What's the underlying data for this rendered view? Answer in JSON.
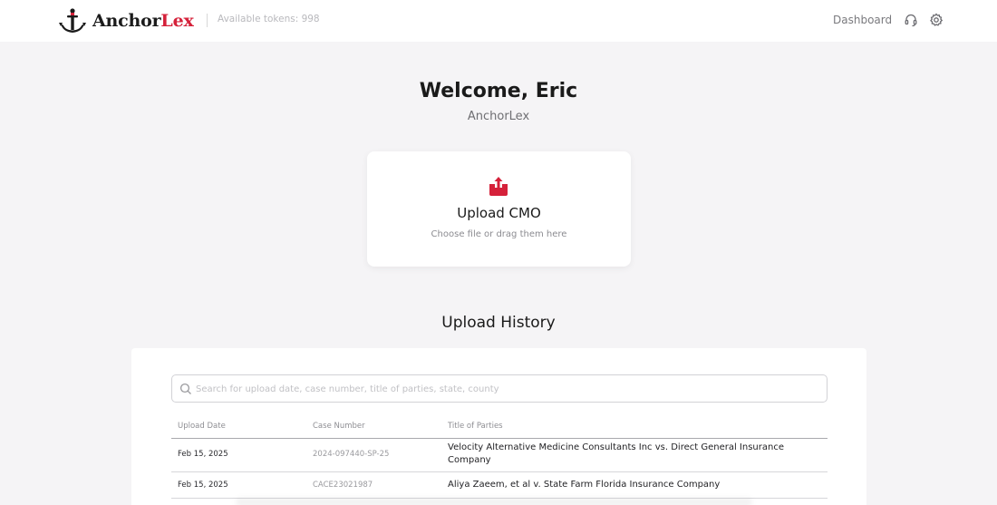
{
  "header": {
    "logo_part1": "Anchor",
    "logo_part2": "Lex",
    "tokens_label": "Available tokens: 998",
    "nav_dashboard": "Dashboard",
    "icons": [
      "anchor-logo-icon",
      "headset-icon",
      "gear-icon"
    ]
  },
  "main": {
    "welcome": "Welcome, Eric",
    "org_name": "AnchorLex"
  },
  "upload": {
    "title": "Upload CMO",
    "hint": "Choose file or drag them here",
    "icon": "upload-icon",
    "accent_color": "#d5213a"
  },
  "history": {
    "title": "Upload History",
    "search_placeholder": "Search for upload date, case number, title of parties, state, county",
    "columns": [
      "Upload Date",
      "Case Number",
      "Title of Parties"
    ],
    "rows": [
      {
        "date": "Feb 15, 2025",
        "case": "2024-097440-SP-25",
        "parties": "Velocity Alternative Medicine Consultants Inc vs. Direct General Insurance Company"
      },
      {
        "date": "Feb 15, 2025",
        "case": "CACE23021987",
        "parties": "Aliya Zaeem, et al v. State Farm Florida Insurance Company"
      }
    ]
  }
}
